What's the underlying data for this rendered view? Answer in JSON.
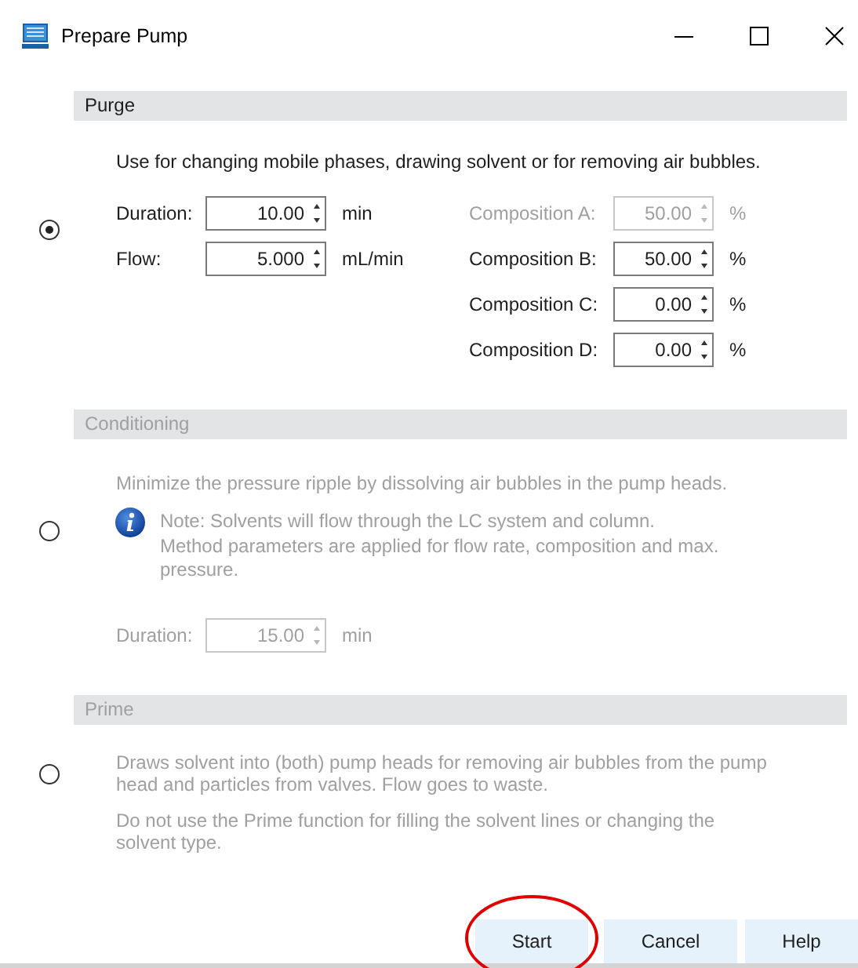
{
  "window": {
    "title": "Prepare Pump"
  },
  "sections": [
    {
      "title": "Purge",
      "selected": true,
      "disabled": false,
      "paragraphs": [
        "Use for changing mobile phases, drawing solvent or for removing air bubbles."
      ],
      "left_fields": [
        {
          "label": "Duration:",
          "value": "10.00",
          "unit": "min",
          "disabled": false
        },
        {
          "label": "Flow:",
          "value": "5.000",
          "unit": "mL/min",
          "disabled": false
        }
      ],
      "right_fields": [
        {
          "label": "Composition A:",
          "value": "50.00",
          "unit": "%",
          "disabled": true
        },
        {
          "label": "Composition B:",
          "value": "50.00",
          "unit": "%",
          "disabled": false
        },
        {
          "label": "Composition C:",
          "value": "0.00",
          "unit": "%",
          "disabled": false
        },
        {
          "label": "Composition D:",
          "value": "0.00",
          "unit": "%",
          "disabled": false
        }
      ]
    },
    {
      "title": "Conditioning",
      "selected": false,
      "disabled": true,
      "paragraphs": [
        "Minimize the pressure ripple by dissolving air bubbles in the pump heads."
      ],
      "note": [
        "Note: Solvents will flow through the LC system and column.",
        "Method parameters are applied for flow rate, composition and max.",
        "pressure."
      ],
      "left_fields": [
        {
          "label": "Duration:",
          "value": "15.00",
          "unit": "min",
          "disabled": true
        }
      ]
    },
    {
      "title": "Prime",
      "selected": false,
      "disabled": true,
      "paragraphs": [
        "Draws solvent into (both) pump heads for removing air bubbles from the pump head and particles from valves. Flow goes to waste.",
        "Do not use the Prime function for filling the solvent lines or changing the solvent type."
      ]
    }
  ],
  "buttons": [
    {
      "label": "Start",
      "circled": true
    },
    {
      "label": "Cancel",
      "circled": false
    },
    {
      "label": "Help",
      "circled": false
    }
  ]
}
